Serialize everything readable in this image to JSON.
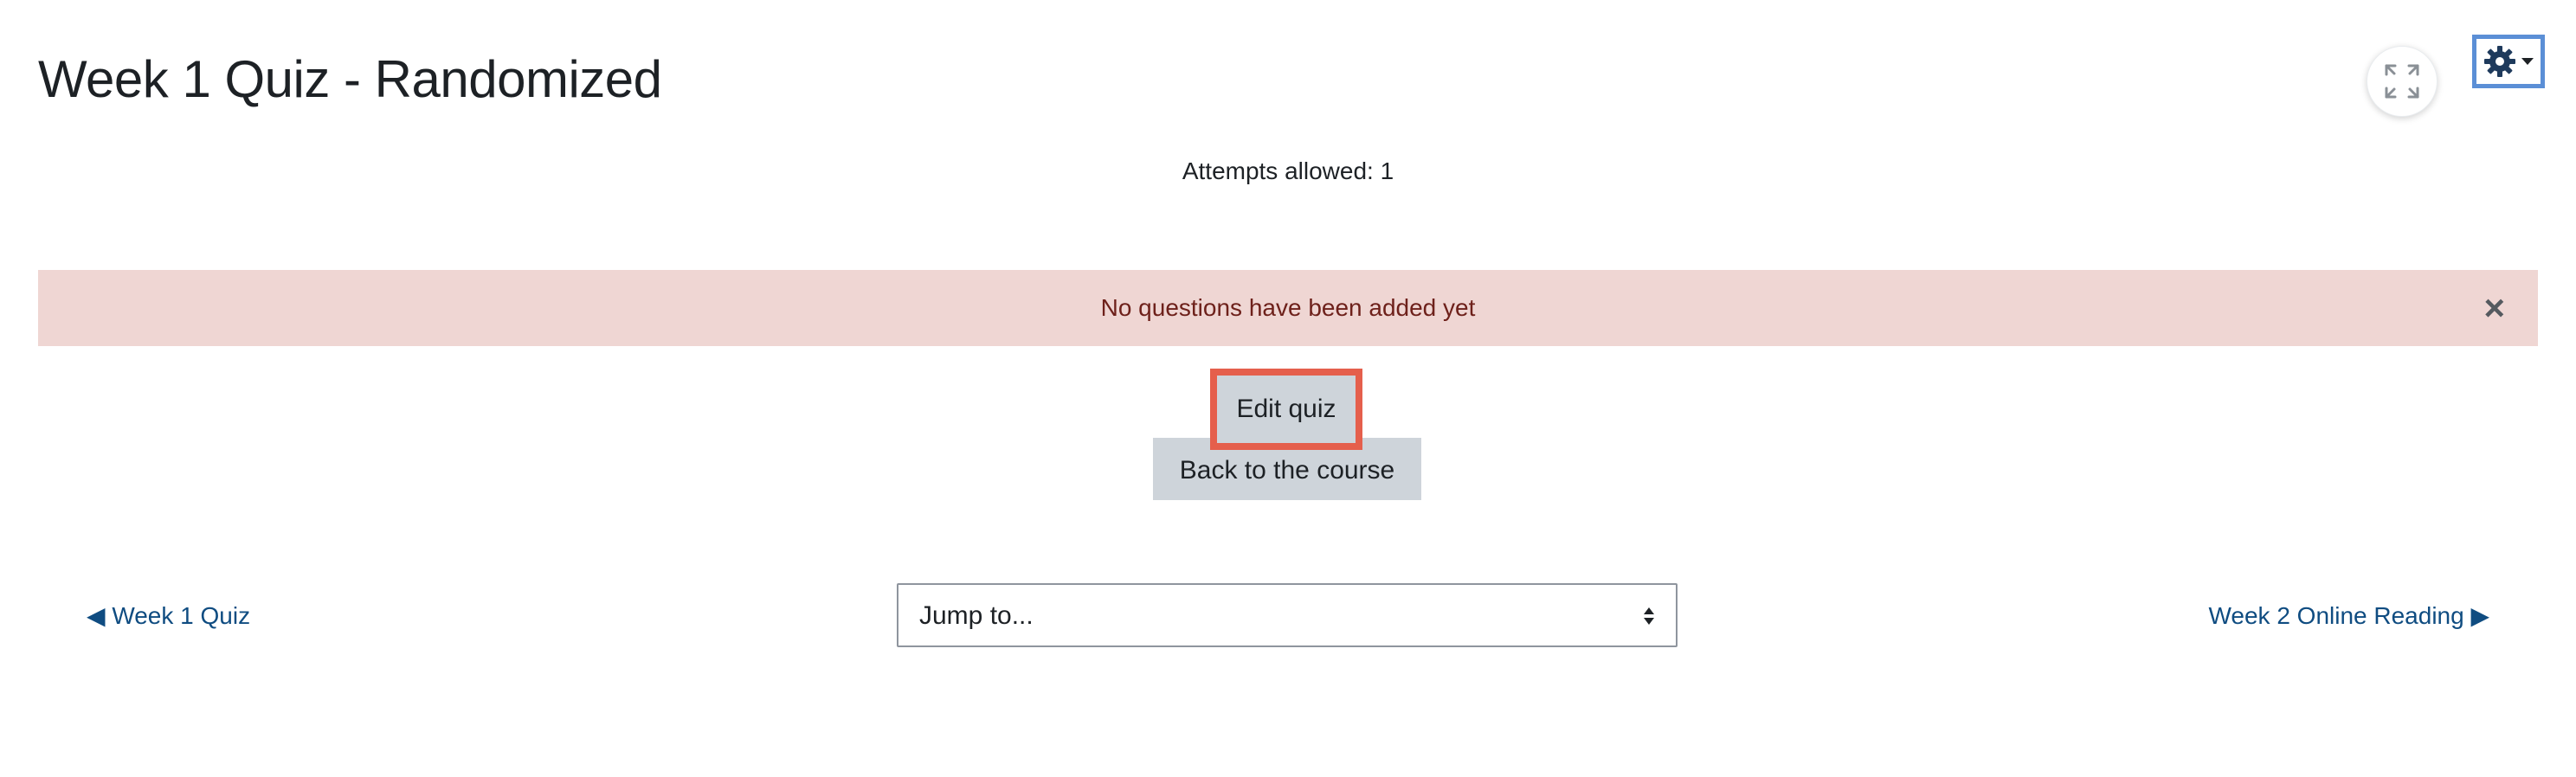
{
  "page": {
    "title": "Week 1 Quiz - Randomized"
  },
  "header_actions": {
    "fullscreen_icon": "expand-arrows-icon",
    "settings_icon": "gear-icon",
    "settings_caret_icon": "caret-down-icon"
  },
  "quiz_info": {
    "attempts_allowed": "Attempts allowed: 1"
  },
  "alert": {
    "message": "No questions have been added yet",
    "close_label": "×",
    "background_color": "#efd6d3",
    "text_color": "#6e211b"
  },
  "actions": {
    "edit_quiz_label": "Edit quiz",
    "back_to_course_label": "Back to the course",
    "highlight_color": "#e55f4c"
  },
  "navigation": {
    "prev_label": "◀ Week 1 Quiz",
    "next_label": "Week 2 Online Reading ▶",
    "jump_select_value": "Jump to...",
    "link_color": "#0f4c81"
  }
}
